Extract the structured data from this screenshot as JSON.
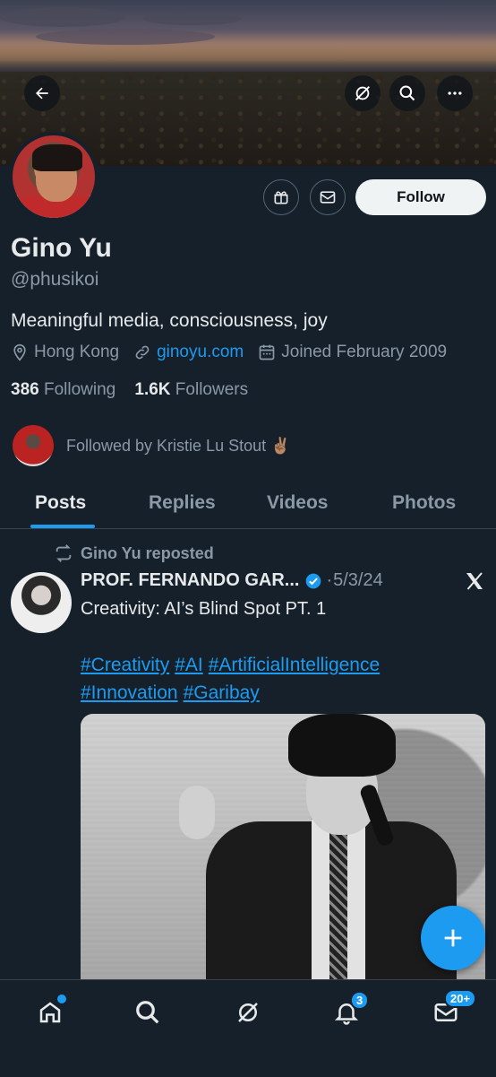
{
  "profile": {
    "name": "Gino Yu",
    "handle": "@phusikoi",
    "bio": "Meaningful media, consciousness, joy",
    "location": "Hong Kong",
    "website": "ginoyu.com",
    "joined": "Joined February 2009",
    "following_count": "386",
    "following_label": "Following",
    "followers_count": "1.6K",
    "followers_label": "Followers",
    "followed_by": "Followed by Kristie Lu Stout ✌🏽",
    "follow_button": "Follow"
  },
  "tabs": [
    {
      "label": "Posts",
      "active": true
    },
    {
      "label": "Replies"
    },
    {
      "label": "Videos"
    },
    {
      "label": "Photos"
    }
  ],
  "post": {
    "repost_label": "Gino Yu reposted",
    "author": "PROF. FERNANDO GAR...",
    "date": "5/3/24",
    "text": "Creativity: AI’s Blind Spot PT. 1",
    "hashtags": [
      "#Creativity",
      "#AI",
      "#ArtificialIntelligence",
      "#Innovation",
      "#Garibay"
    ]
  },
  "nav": {
    "notifications_badge": "3",
    "messages_badge": "20+"
  },
  "colors": {
    "background": "#15202b",
    "accent": "#1d9bf0",
    "secondary_text": "#8b98a5"
  }
}
